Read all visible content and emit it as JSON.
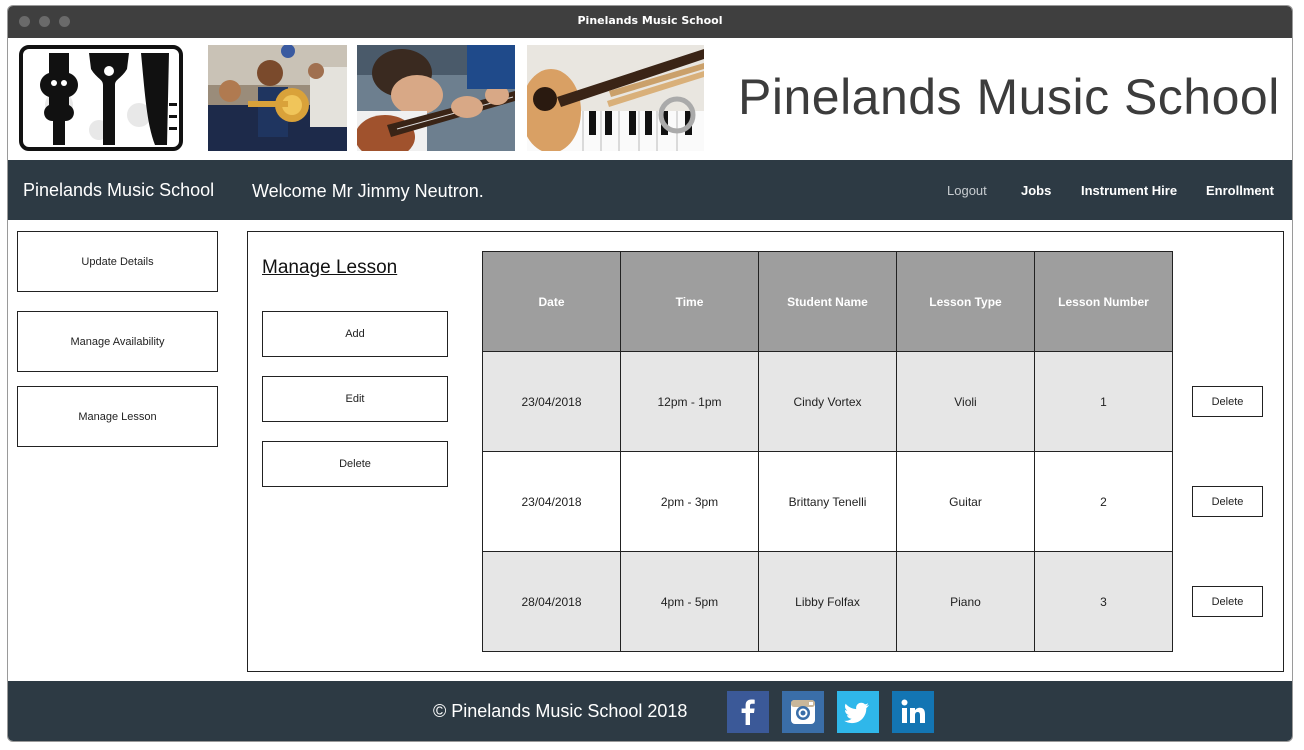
{
  "window": {
    "title": "Pinelands Music School"
  },
  "banner": {
    "title": "Pinelands Music School"
  },
  "navbar": {
    "brand": "Pinelands Music School",
    "welcome": "Welcome Mr Jimmy Neutron.",
    "links": {
      "logout": "Logout",
      "jobs": "Jobs",
      "instrument_hire": "Instrument Hire",
      "enrollment": "Enrollment"
    }
  },
  "sidebar": {
    "items": [
      {
        "label": "Update Details"
      },
      {
        "label": "Manage Availability"
      },
      {
        "label": "Manage Lesson"
      }
    ]
  },
  "main": {
    "title": "Manage Lesson",
    "actions": {
      "add": "Add",
      "edit": "Edit",
      "delete": "Delete"
    },
    "table": {
      "headers": [
        "Date",
        "Time",
        "Student Name",
        "Lesson Type",
        "Lesson Number"
      ],
      "rows": [
        [
          "23/04/2018",
          "12pm - 1pm",
          "Cindy Vortex",
          "Violi",
          "1"
        ],
        [
          "23/04/2018",
          "2pm - 3pm",
          "Brittany Tenelli",
          "Guitar",
          "2"
        ],
        [
          "28/04/2018",
          "4pm - 5pm",
          "Libby Folfax",
          "Piano",
          "3"
        ]
      ],
      "row_action": "Delete"
    }
  },
  "footer": {
    "copyright": "© Pinelands Music School   2018",
    "social": [
      "facebook-icon",
      "instagram-icon",
      "twitter-icon",
      "linkedin-icon"
    ]
  },
  "colors": {
    "navbar": "#2d3a44",
    "header_cell": "#9e9e9e",
    "alt_row": "#e6e6e6",
    "facebook": "#3b5998",
    "instagram": "#3a6ea8",
    "twitter": "#2fb7ea",
    "linkedin": "#1375b3"
  }
}
